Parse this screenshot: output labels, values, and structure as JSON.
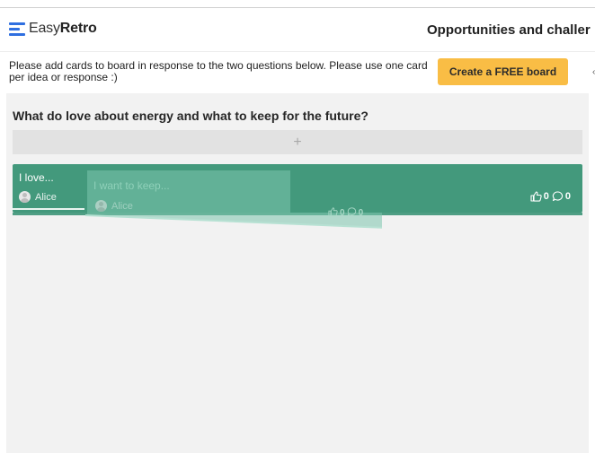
{
  "app": {
    "brand_light": "Easy",
    "brand_bold": "Retro",
    "board_title": "Opportunities and challer"
  },
  "banner": {
    "message": "Please add cards to board in response to the two questions below. Please use one card per idea or response :)",
    "cta_label": "Create a FREE board",
    "cta_color": "#f9bd45"
  },
  "column": {
    "question": "What do love about energy and what to keep for the future?",
    "add_symbol": "+"
  },
  "cards": [
    {
      "text": "I love...",
      "author": "Alice",
      "likes": "0",
      "comments": "0",
      "color": "#43997c"
    }
  ],
  "dragging_card": {
    "text": "I want to keep...",
    "author": "Alice",
    "likes": "0",
    "comments": "0"
  },
  "icons": {
    "logo": "easyretro-logo-icon",
    "like": "thumbs-up-icon",
    "comment": "comment-bubble-icon",
    "avatar": "user-avatar-icon"
  }
}
